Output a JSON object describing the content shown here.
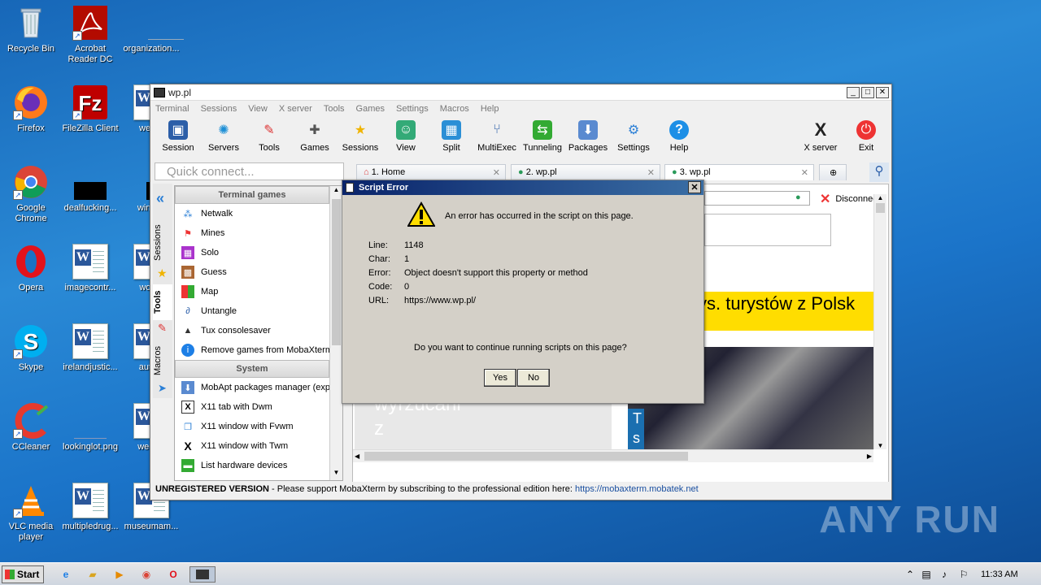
{
  "desktop": {
    "icons": [
      {
        "label": "Recycle Bin"
      },
      {
        "label": "Acrobat Reader DC"
      },
      {
        "label": "organization..."
      },
      {
        "label": "Firefox"
      },
      {
        "label": "FileZilla Client"
      },
      {
        "label": "weanr"
      },
      {
        "label": "Google Chrome"
      },
      {
        "label": "dealfucking..."
      },
      {
        "label": "winexe"
      },
      {
        "label": "Opera"
      },
      {
        "label": "imagecontr..."
      },
      {
        "label": "woma"
      },
      {
        "label": "Skype"
      },
      {
        "label": "irelandjustic..."
      },
      {
        "label": "autom"
      },
      {
        "label": "CCleaner"
      },
      {
        "label": "lookinglot.png"
      },
      {
        "label": "weekly"
      },
      {
        "label": "VLC media player"
      },
      {
        "label": "multipledrug..."
      },
      {
        "label": "museumam..."
      }
    ],
    "watermark": "ANY RUN"
  },
  "window": {
    "title": "wp.pl",
    "menu": [
      "Terminal",
      "Sessions",
      "View",
      "X server",
      "Tools",
      "Games",
      "Settings",
      "Macros",
      "Help"
    ],
    "toolbar": [
      "Session",
      "Servers",
      "Tools",
      "Games",
      "Sessions",
      "View",
      "Split",
      "MultiExec",
      "Tunneling",
      "Packages",
      "Settings",
      "Help"
    ],
    "toolbar_right": [
      "X server",
      "Exit"
    ],
    "quick_connect_placeholder": "Quick connect...",
    "tabs": [
      "1. Home",
      "2. wp.pl",
      "3. wp.pl"
    ],
    "disconnect": "Disconnect",
    "side_tabs": [
      "Sessions",
      "Tools",
      "Macros"
    ],
    "tools_panel": {
      "terminal_games_header": "Terminal games",
      "terminal_games": [
        "Netwalk",
        "Mines",
        "Solo",
        "Guess",
        "Map",
        "Untangle",
        "Tux consolesaver",
        "Remove games from MobaXterm"
      ],
      "system_header": "System",
      "system": [
        "MobApt packages manager (expe",
        "X11 tab with Dwm",
        "X11 window with Fvwm",
        "X11 window with Twm",
        "List hardware devices"
      ]
    },
    "page": {
      "headline": "ys. turystów z Polsk",
      "text1": "wyrzucani",
      "text2": "z",
      "side1": "T",
      "side2": "s"
    },
    "status": {
      "unregistered": "UNREGISTERED VERSION",
      "message": "-  Please support MobaXterm by subscribing to the professional edition here:",
      "link": "https://mobaxterm.mobatek.net"
    }
  },
  "dialog": {
    "title": "Script Error",
    "message": "An error has occurred in the script on this page.",
    "fields": [
      {
        "label": "Line:",
        "value": "1148"
      },
      {
        "label": "Char:",
        "value": "1"
      },
      {
        "label": "Error:",
        "value": "Object doesn't support this property or method"
      },
      {
        "label": "Code:",
        "value": "0"
      },
      {
        "label": "URL:",
        "value": "https://www.wp.pl/"
      }
    ],
    "question": "Do you want to continue running scripts on this page?",
    "yes": "Yes",
    "no": "No"
  },
  "taskbar": {
    "start": "Start",
    "clock": "11:33 AM"
  }
}
